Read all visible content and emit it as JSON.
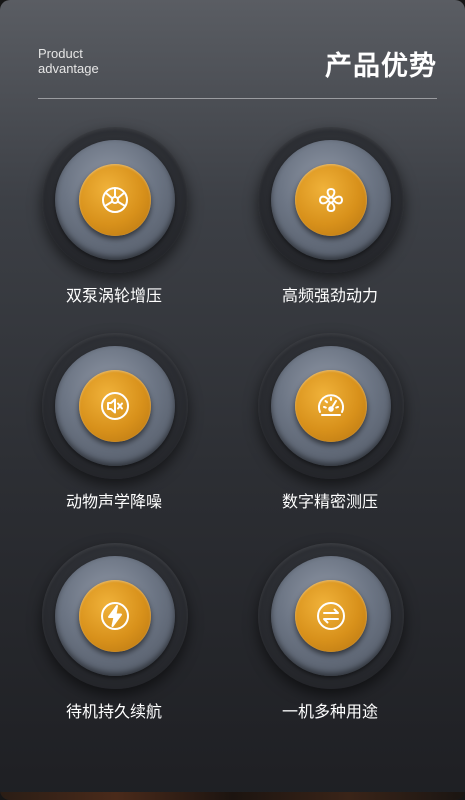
{
  "header": {
    "subtitle_en_line1": "Product",
    "subtitle_en_line2": "advantage",
    "title_cn": "产品优势"
  },
  "features": [
    {
      "label": "双泵涡轮增压",
      "icon": "turbine-icon"
    },
    {
      "label": "高频强劲动力",
      "icon": "fan-icon"
    },
    {
      "label": "动物声学降噪",
      "icon": "speaker-mute-icon"
    },
    {
      "label": "数字精密测压",
      "icon": "gauge-icon"
    },
    {
      "label": "待机持久续航",
      "icon": "lightning-icon"
    },
    {
      "label": "一机多种用途",
      "icon": "swap-arrows-icon"
    }
  ],
  "colors": {
    "accent_gold": "#d8911b",
    "text": "#ffffff"
  }
}
